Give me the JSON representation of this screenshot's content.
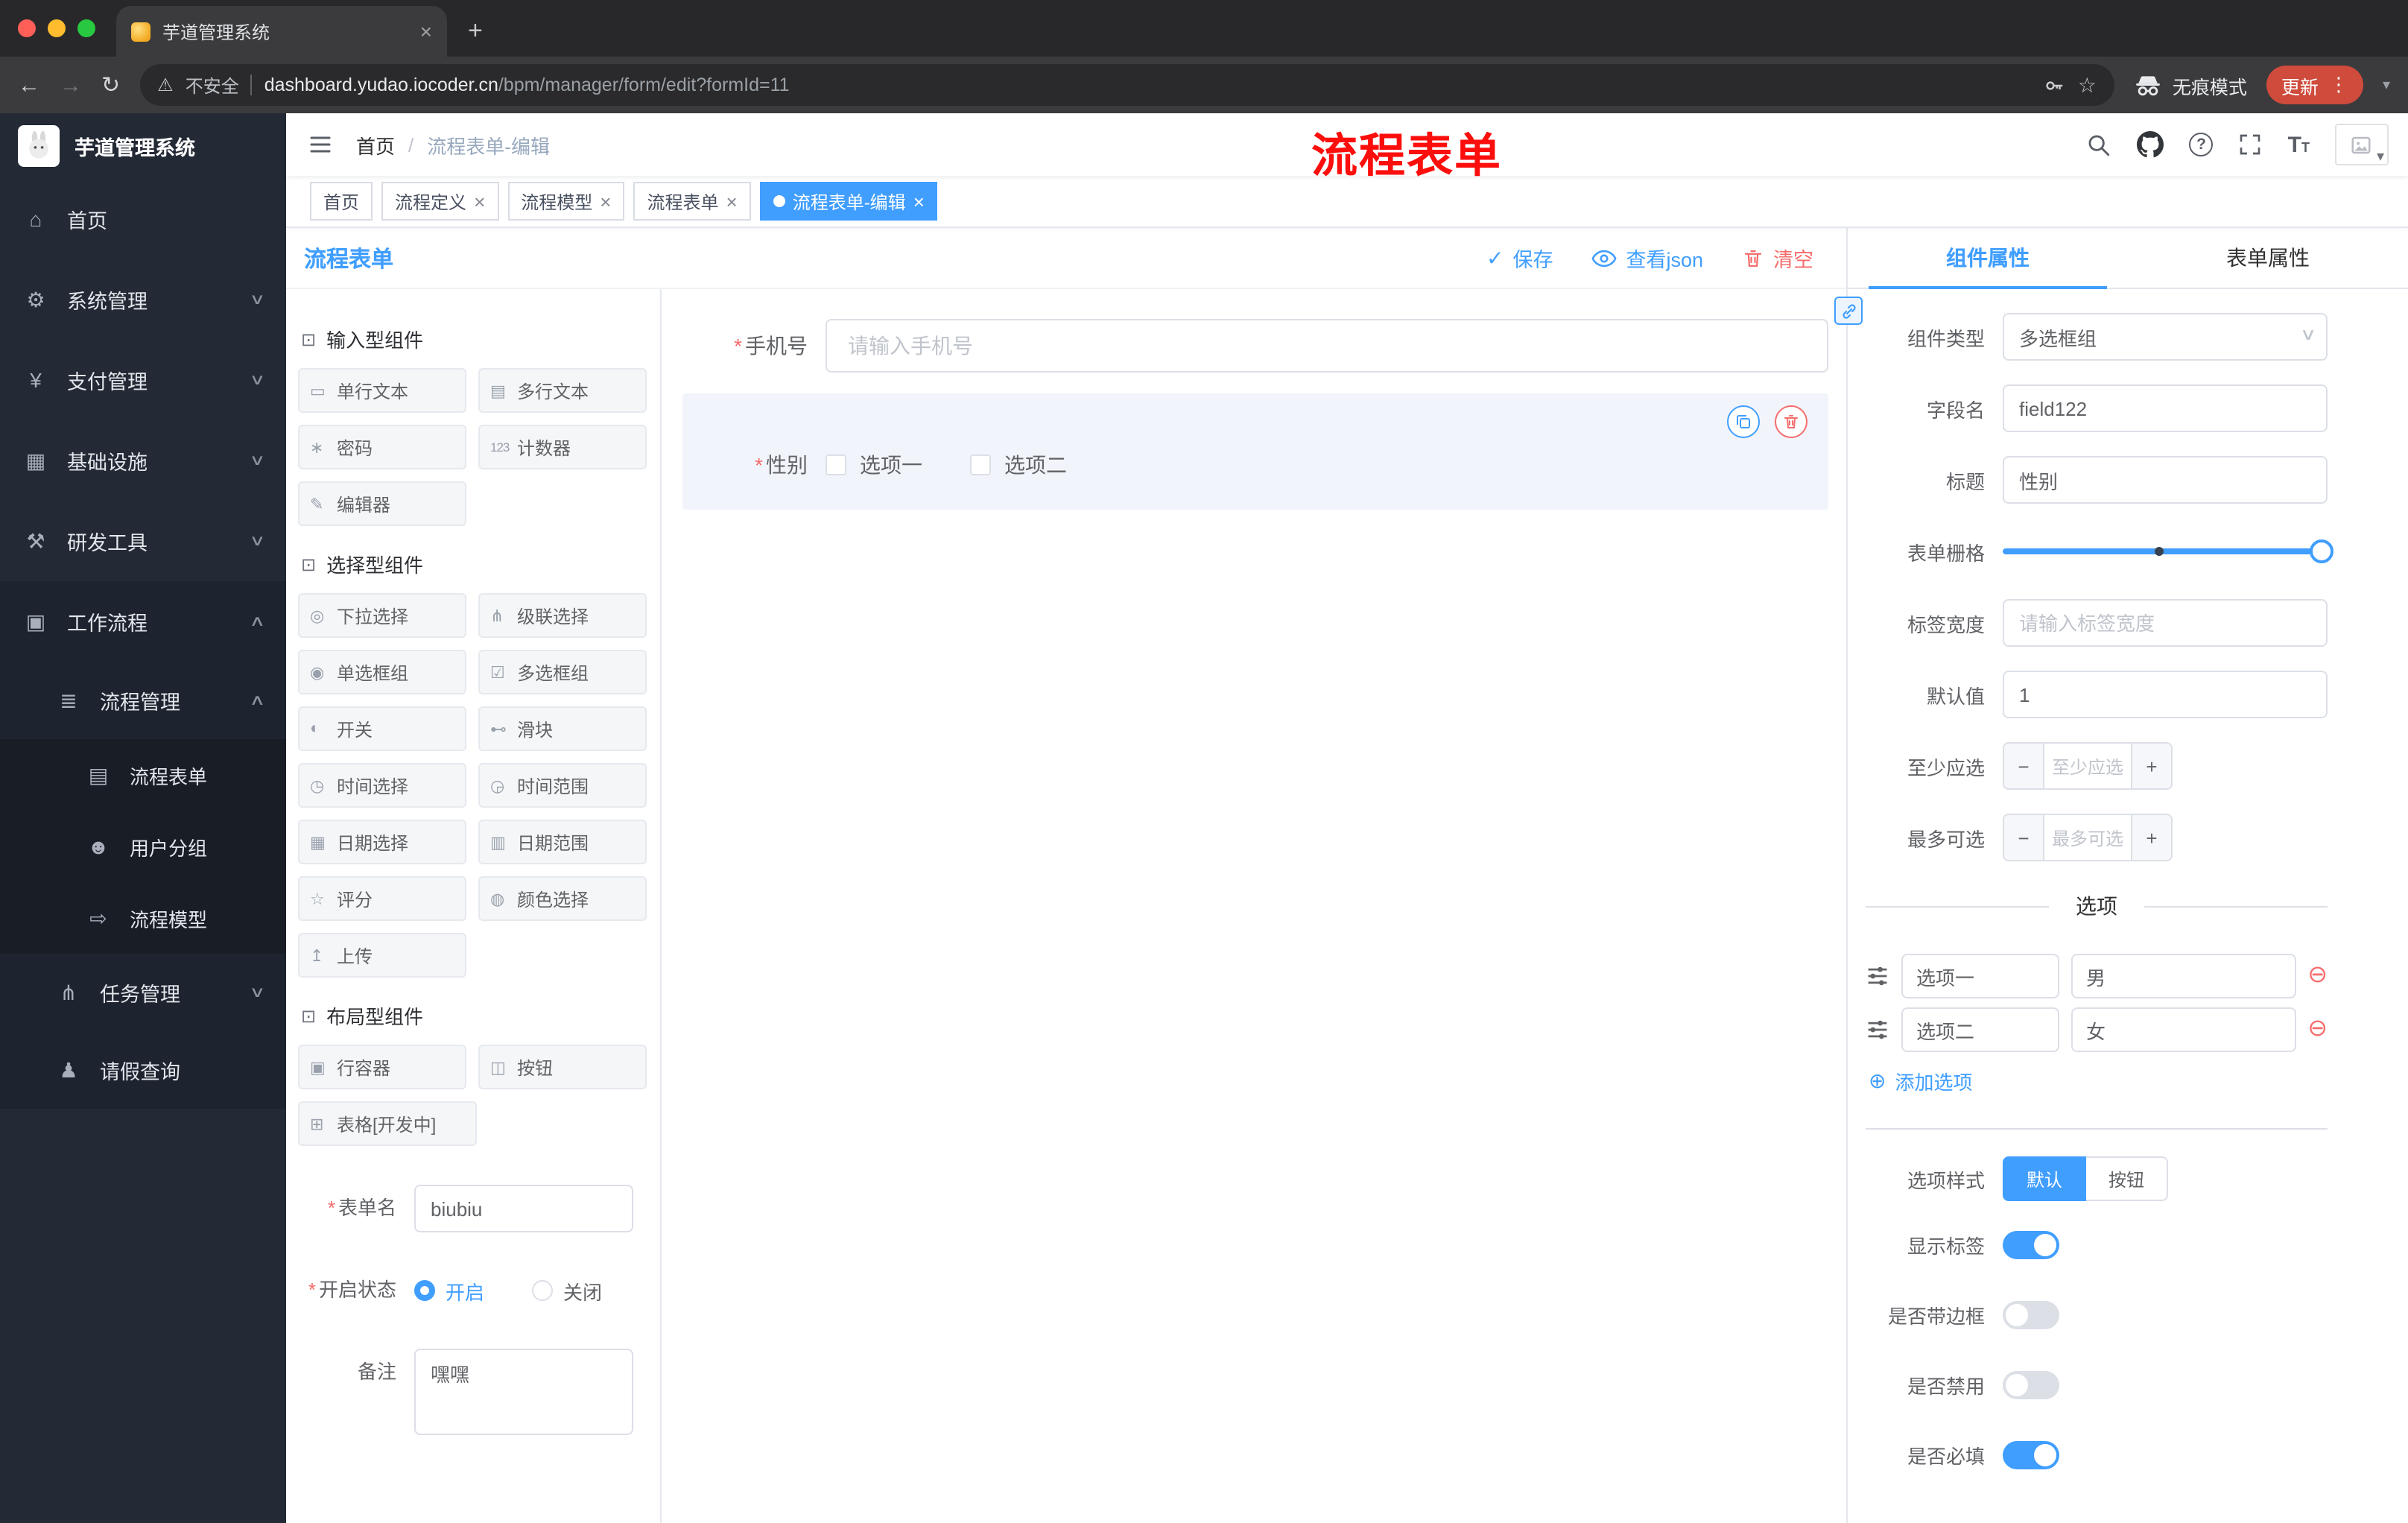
{
  "browser": {
    "tab_title": "芋道管理系统",
    "url_host": "dashboard.yudao.iocoder.cn",
    "url_path": "/bpm/manager/form/edit?formId=11",
    "not_secure": "不安全",
    "incognito": "无痕模式",
    "update": "更新"
  },
  "sidebar": {
    "logo_title": "芋道管理系统",
    "items": [
      {
        "label": "首页"
      },
      {
        "label": "系统管理"
      },
      {
        "label": "支付管理"
      },
      {
        "label": "基础设施"
      },
      {
        "label": "研发工具"
      },
      {
        "label": "工作流程"
      }
    ],
    "process_group_label": "流程管理",
    "process_children": [
      {
        "label": "流程表单"
      },
      {
        "label": "用户分组"
      },
      {
        "label": "流程模型"
      }
    ],
    "task_label": "任务管理",
    "leave_label": "请假查询"
  },
  "header": {
    "breadcrumb_home": "首页",
    "breadcrumb_sep": "/",
    "breadcrumb_current": "流程表单-编辑",
    "overlay_title": "流程表单"
  },
  "tags": [
    {
      "label": "首页"
    },
    {
      "label": "流程定义"
    },
    {
      "label": "流程模型"
    },
    {
      "label": "流程表单"
    },
    {
      "label": "流程表单-编辑"
    }
  ],
  "designer": {
    "panel_title": "流程表单",
    "actions": {
      "save": "保存",
      "view_json": "查看json",
      "clear": "清空"
    },
    "palette": {
      "group1_title": "输入型组件",
      "group1_items": [
        "单行文本",
        "多行文本",
        "密码",
        "计数器",
        "编辑器"
      ],
      "group2_title": "选择型组件",
      "group2_items": [
        "下拉选择",
        "级联选择",
        "单选框组",
        "多选框组",
        "开关",
        "滑块",
        "时间选择",
        "时间范围",
        "日期选择",
        "日期范围",
        "评分",
        "颜色选择",
        "上传"
      ],
      "group3_title": "布局型组件",
      "group3_items": [
        "行容器",
        "按钮",
        "表格[开发中]"
      ]
    },
    "meta": {
      "form_name_label": "表单名",
      "form_name_value": "biubiu",
      "status_label": "开启状态",
      "status_on": "开启",
      "status_off": "关闭",
      "remark_label": "备注",
      "remark_value": "嘿嘿"
    }
  },
  "canvas": {
    "phone_label": "手机号",
    "phone_placeholder": "请输入手机号",
    "gender_label": "性别",
    "gender_option1": "选项一",
    "gender_option2": "选项二"
  },
  "properties": {
    "tab_component": "组件属性",
    "tab_form": "表单属性",
    "rows": {
      "type_label": "组件类型",
      "type_value": "多选框组",
      "field_label": "字段名",
      "field_value": "field122",
      "title_label": "标题",
      "title_value": "性别",
      "grid_label": "表单栅格",
      "width_label": "标签宽度",
      "width_placeholder": "请输入标签宽度",
      "default_label": "默认值",
      "default_value": "1",
      "min_label": "至少应选",
      "min_placeholder": "至少应选",
      "max_label": "最多可选",
      "max_placeholder": "最多可选"
    },
    "options": {
      "divider": "选项",
      "row1_label": "选项一",
      "row1_value": "男",
      "row2_label": "选项二",
      "row2_value": "女",
      "add": "添加选项"
    },
    "style": {
      "label": "选项样式",
      "opt_default": "默认",
      "opt_button": "按钮"
    },
    "toggles": {
      "show_label": "显示标签",
      "border_label": "是否带边框",
      "disabled_label": "是否禁用",
      "required_label": "是否必填"
    }
  },
  "colors": {
    "accent": "#409eff",
    "danger": "#f56c6c",
    "annotation_red": "#fb0e0c"
  },
  "icons": {
    "hamburger": "☰",
    "home": "⌂",
    "system": "⚙",
    "payment": "¥",
    "infrastructure": "▦",
    "devtools": "⚒",
    "workflow": "▣",
    "process-management": "≣",
    "process-form": "▤",
    "user-group": "☻",
    "process-model": "⇨",
    "task-management": "⋔",
    "leave-query": "♟",
    "chevron-down": "∨",
    "chevron-up": "∧",
    "group-header": "⊡",
    "single-text": "▭",
    "multi-text": "▤",
    "password": "∗",
    "counter": "123",
    "editor": "✎",
    "select": "◎",
    "cascader": "⋔",
    "radio-group": "◉",
    "checkbox-group": "☑",
    "switch": "◐",
    "slider": "⊷",
    "time": "◷",
    "time-range": "◶",
    "date": "▦",
    "date-range": "▥",
    "rate": "☆",
    "color": "◍",
    "upload": "↥",
    "row-container": "▣",
    "button": "◫",
    "table": "⊞",
    "check": "✓",
    "plus-circle": "⊕",
    "minus-circle": "⊖",
    "warning": "⚠",
    "star": "☆",
    "kebab": "⋮",
    "back": "←",
    "forward": "→",
    "reload": "↻",
    "plus": "+",
    "close": "×",
    "caret-down": "▾",
    "question": "?"
  }
}
